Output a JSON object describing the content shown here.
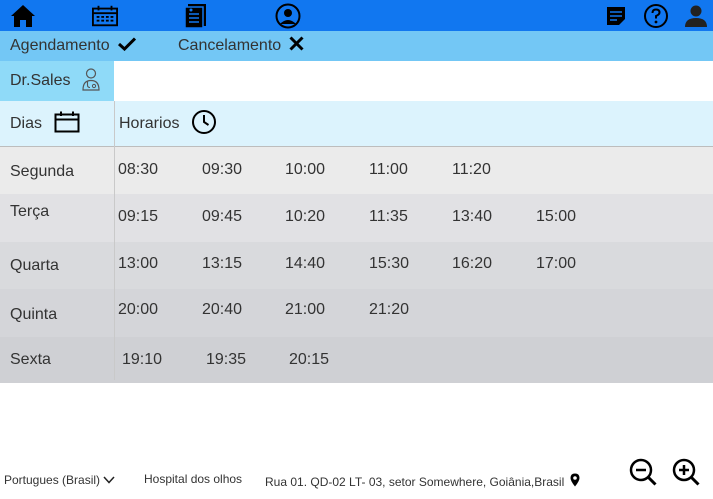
{
  "topbar": {
    "icons": [
      "home-icon",
      "calendar-icon",
      "records-icon",
      "doctor-icon",
      "notes-icon",
      "help-icon",
      "user-icon"
    ],
    "background": "#1177f0"
  },
  "tabs": [
    {
      "label": "Agendamento",
      "icon": "check-icon"
    },
    {
      "label": "Cancelamento",
      "icon": "close-icon"
    }
  ],
  "doctor": {
    "name": "Dr.Sales",
    "icon": "doctor-icon"
  },
  "table": {
    "headers": {
      "days": "Dias",
      "times": "Horarios"
    },
    "rows": [
      {
        "day": "Segunda",
        "times": [
          "08:30",
          "09:30",
          "10:00",
          "11:00",
          "11:20"
        ]
      },
      {
        "day": "Terça",
        "times": [
          "09:15",
          "09:45",
          "10:20",
          "11:35",
          "13:40",
          "15:00"
        ]
      },
      {
        "day": "Quarta",
        "times": [
          "13:00",
          "13:15",
          "14:40",
          "15:30",
          "16:20",
          "17:00"
        ]
      },
      {
        "day": "Quinta",
        "times": [
          "20:00",
          "20:40",
          "21:00",
          "21:20"
        ]
      },
      {
        "day": "Sexta",
        "times": [
          "19:10",
          "19:35",
          "20:15"
        ]
      }
    ]
  },
  "footer": {
    "language": "Portugues (Brasil)",
    "hospital": "Hospital dos olhos",
    "address": "Rua 01. QD-02 LT- 03, setor Somewhere, Goiânia,Brasil"
  },
  "colors": {
    "topbar": "#1177f0",
    "tabbar": "#73c7f5",
    "doctor_chip": "#8fdaf8",
    "header": "#dcf3fd"
  }
}
